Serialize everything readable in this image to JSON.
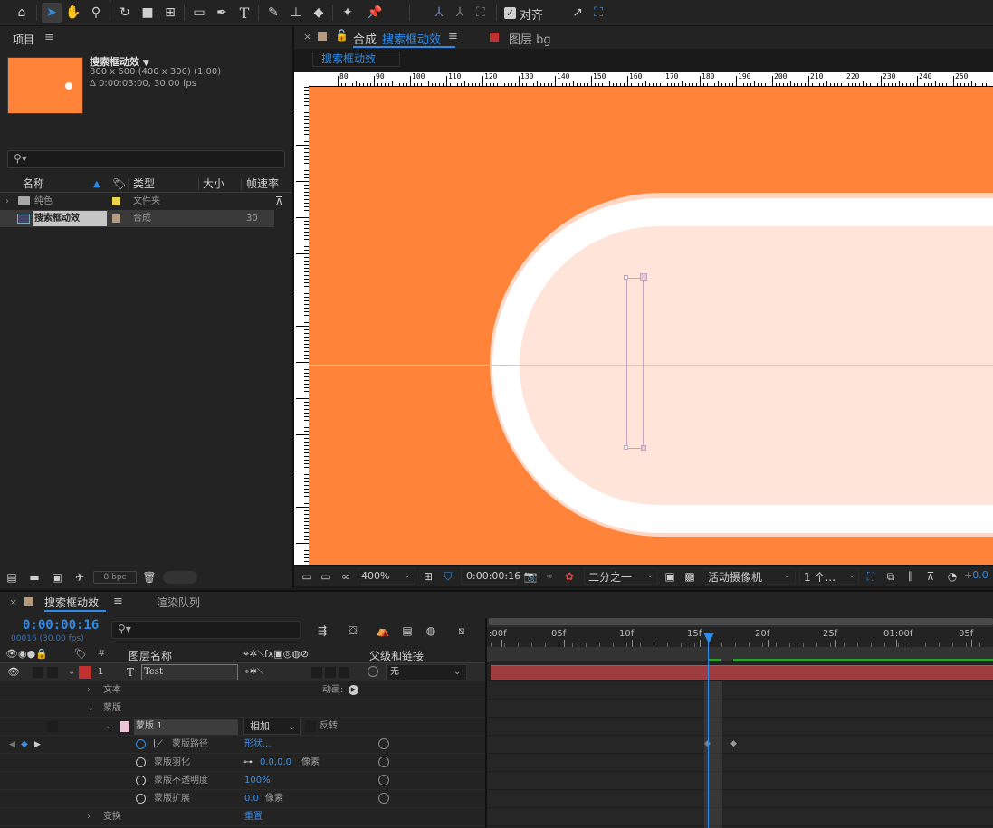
{
  "toolbar": {
    "tools": [
      "home-icon",
      "selection-tool-icon",
      "hand-tool-icon",
      "zoom-tool-icon",
      "rotate-tool-icon",
      "camera-tool-icon",
      "pan-behind-icon",
      "rectangle-tool-icon",
      "pen-tool-icon",
      "type-tool-icon",
      "brush-tool-icon",
      "clone-stamp-icon",
      "eraser-tool-icon",
      "roto-brush-icon",
      "puppet-pin-icon"
    ],
    "snap_label": "对齐"
  },
  "project": {
    "tab_label": "项目",
    "comp_name": "搜索框动效",
    "comp_dims": "800 x 600  (400 x 300) (1.00)",
    "comp_duration": "Δ 0:00:03:00, 30.00 fps",
    "columns": {
      "name": "名称",
      "type": "类型",
      "size": "大小",
      "fps": "帧速率"
    },
    "items": [
      {
        "name": "纯色",
        "type": "文件夹",
        "fps": "",
        "label_color": "#e8d34a"
      },
      {
        "name": "搜索框动效",
        "type": "合成",
        "fps": "30",
        "label_color": "#b59a80"
      }
    ],
    "bpc": "8 bpc"
  },
  "viewer": {
    "tab_prefix": "合成",
    "tab_comp": "搜索框动效",
    "layer_tab": "图层 bg",
    "sub_tab": "搜索框动效",
    "ruler_labels": [
      "80",
      "90",
      "100",
      "110",
      "120",
      "130",
      "140",
      "150",
      "160",
      "170",
      "180",
      "190",
      "200",
      "210",
      "220",
      "230",
      "240",
      "250"
    ],
    "zoom": "400%",
    "timecode": "0:00:00:16",
    "resolution": "二分之一",
    "camera": "活动摄像机",
    "views": "1 个...",
    "exposure": "+0.0"
  },
  "timeline": {
    "tab_comp": "搜索框动效",
    "tab_render": "渲染队列",
    "current_time": "0:00:00:16",
    "frame_info": "00016 (30.00 fps)",
    "col_layer_name": "图层名称",
    "col_parent": "父级和链接",
    "ruler": [
      ":00f",
      "05f",
      "10f",
      "15f",
      "20f",
      "25f",
      "01:00f",
      "05f"
    ],
    "layer": {
      "index": "1",
      "name": "Test",
      "parent": "无",
      "label_color": "#c0312f"
    },
    "rows": {
      "text": "文本",
      "animate": "动画:",
      "masks": "蒙版",
      "mask_name": "蒙版 1",
      "mask_mode": "相加",
      "invert": "反转",
      "mask_path": "蒙版路径",
      "mask_path_value": "形状...",
      "mask_feather": "蒙版羽化",
      "mask_feather_value": "0.0,0.0",
      "mask_opacity": "蒙版不透明度",
      "mask_opacity_value": "100%",
      "mask_expansion": "蒙版扩展",
      "mask_expansion_value": "0.0",
      "unit_px": "像素",
      "transform": "变换",
      "reset": "重置"
    }
  }
}
